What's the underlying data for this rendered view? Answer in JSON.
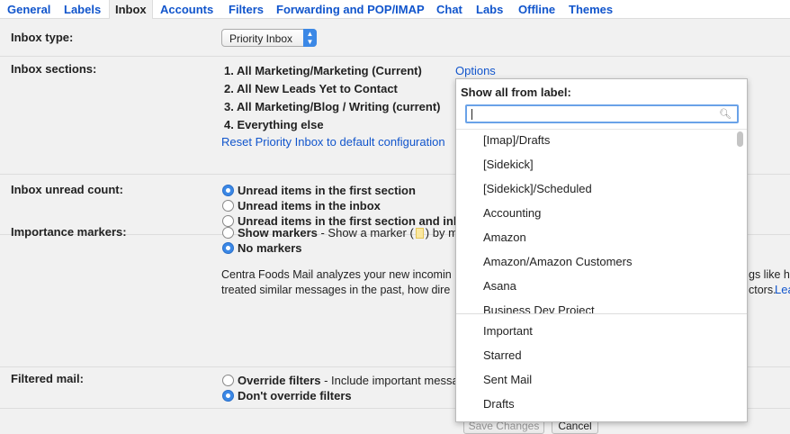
{
  "tabs": [
    {
      "label": "General"
    },
    {
      "label": "Labels"
    },
    {
      "label": "Inbox"
    },
    {
      "label": "Accounts"
    },
    {
      "label": "Filters"
    },
    {
      "label": "Forwarding and POP/IMAP"
    },
    {
      "label": "Chat"
    },
    {
      "label": "Labs"
    },
    {
      "label": "Offline"
    },
    {
      "label": "Themes"
    }
  ],
  "active_tab": "Inbox",
  "inbox_type": {
    "label": "Inbox type:",
    "selected": "Priority Inbox"
  },
  "inbox_sections": {
    "label": "Inbox sections:",
    "items": [
      "1. All Marketing/Marketing (Current)",
      "2. All New Leads Yet to Contact",
      "3. All Marketing/Blog / Writing (current)",
      "4. Everything else"
    ],
    "options_link": "Options",
    "reset_link": "Reset Priority Inbox to default configuration"
  },
  "unread_count": {
    "label": "Inbox unread count:",
    "options": [
      {
        "text": "Unread items in the first section",
        "selected": true
      },
      {
        "text": "Unread items in the inbox",
        "selected": false
      },
      {
        "text": "Unread items in the first section and inb",
        "selected": false
      }
    ]
  },
  "importance_markers": {
    "label": "Importance markers:",
    "show_label": "Show markers",
    "show_desc_before": " - Show a marker (",
    "show_desc_after": ") by m",
    "no_label": "No markers",
    "para_line1_left": "Centra Foods Mail analyzes your new incomin",
    "para_line1_right": "gs like ho",
    "para_line2_left": "treated similar messages in the past, how dire",
    "para_line2_right": "ctors.",
    "para_line2_link": "Lea"
  },
  "filtered_mail": {
    "label": "Filtered mail:",
    "override_label": "Override filters",
    "override_desc": " - Include important messa",
    "dont_label": "Don't override filters"
  },
  "buttons": {
    "save": "Save Changes",
    "cancel": "Cancel"
  },
  "dropdown": {
    "title": "Show all from label:",
    "search_value": "",
    "search_icon": "magnifier-icon",
    "labels": [
      "[Imap]/Drafts",
      "[Sidekick]",
      "[Sidekick]/Scheduled",
      "Accounting",
      "Amazon",
      "Amazon/Amazon Customers",
      "Asana",
      "Business Dev Project"
    ],
    "system_labels": [
      "Important",
      "Starred",
      "Sent Mail",
      "Drafts"
    ]
  },
  "colors": {
    "link": "#1155cc",
    "accent": "#3b88e6",
    "panel_bg": "#f1f1f1"
  }
}
